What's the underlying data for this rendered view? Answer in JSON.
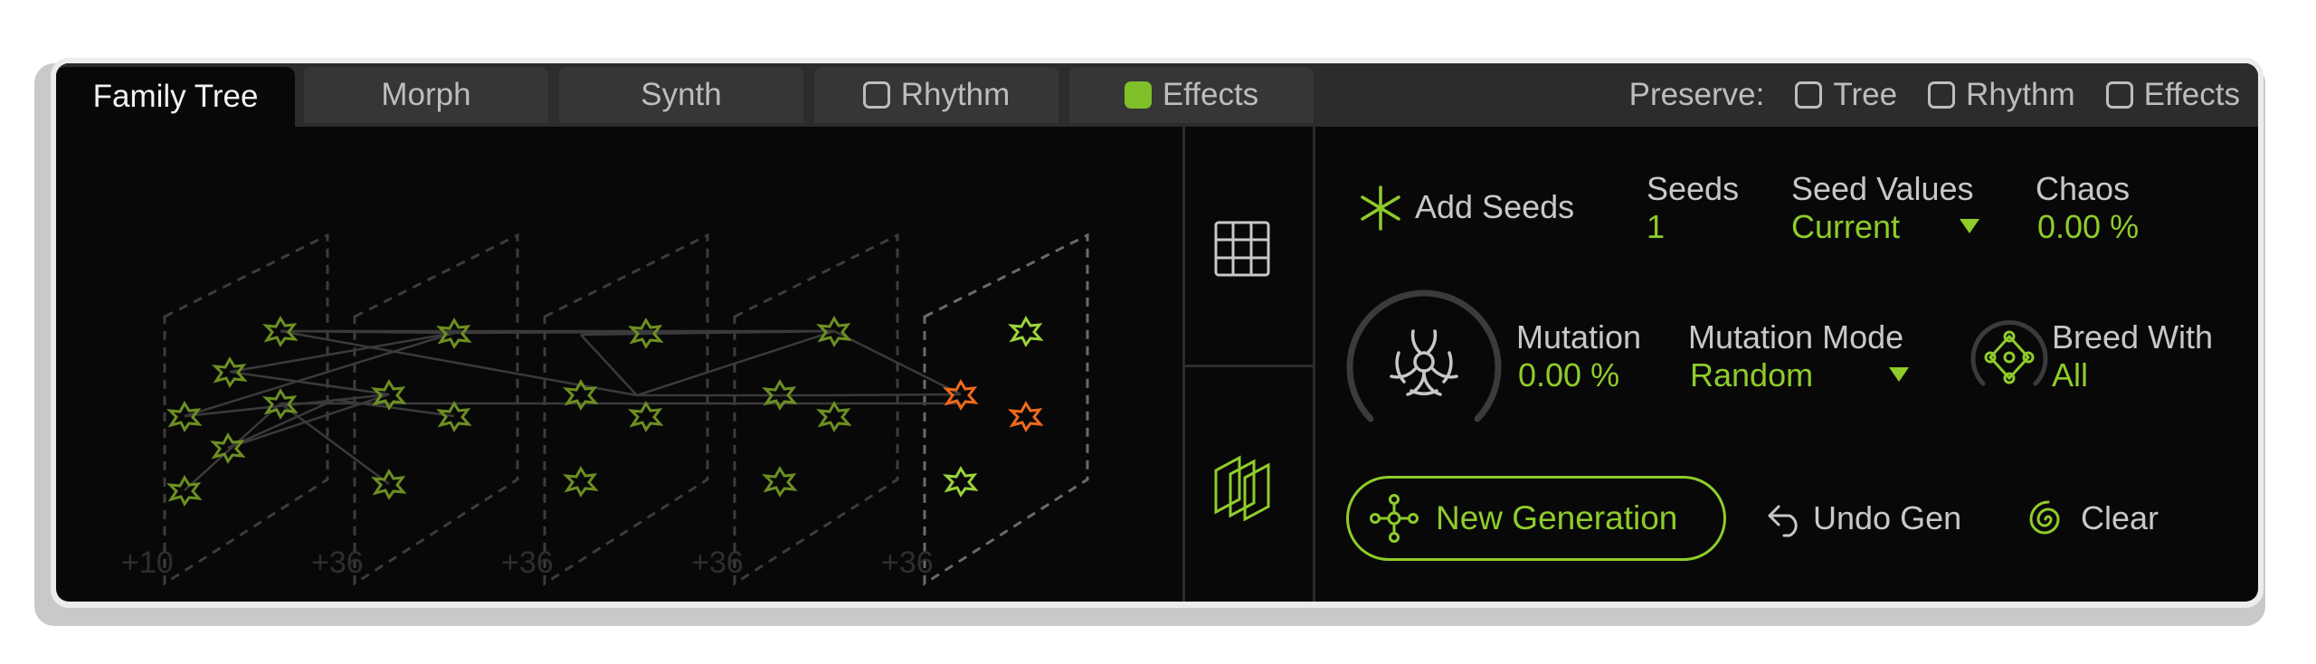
{
  "tabs": [
    {
      "label": "Family Tree"
    },
    {
      "label": "Morph"
    },
    {
      "label": "Synth"
    },
    {
      "label": "Rhythm",
      "checkbox": false
    },
    {
      "label": "Effects",
      "checkbox": true
    }
  ],
  "preserve": {
    "label": "Preserve:",
    "items": [
      {
        "label": "Tree",
        "checked": false
      },
      {
        "label": "Rhythm",
        "checked": false
      },
      {
        "label": "Effects",
        "checked": false
      }
    ]
  },
  "tree": {
    "generation_labels": [
      "+10",
      "+36",
      "+36",
      "+36",
      "+36"
    ]
  },
  "controls": {
    "add_seeds": "Add Seeds",
    "seeds_label": "Seeds",
    "seeds_value": "1",
    "seed_values_label": "Seed Values",
    "seed_values_value": "Current",
    "chaos_label": "Chaos",
    "chaos_value": "0.00 %",
    "mutation_label": "Mutation",
    "mutation_value": "0.00 %",
    "mutation_mode_label": "Mutation Mode",
    "mutation_mode_value": "Random",
    "breed_with_label": "Breed With",
    "breed_with_value": "All",
    "new_generation": "New Generation",
    "undo_gen": "Undo Gen",
    "clear": "Clear"
  },
  "icons": {
    "grid": "grid-icon",
    "layers": "layers-icon",
    "asterisk": "asterisk-icon",
    "biohazard": "biohazard-icon",
    "breed": "breed-icon",
    "new_gen": "branch-icon",
    "undo": "undo-arrow-icon",
    "clear": "spiral-icon"
  },
  "colors": {
    "accent": "#8fcc2a",
    "highlight": "#f06a1c",
    "background": "#080808",
    "tabbar": "#2c2c2c"
  }
}
